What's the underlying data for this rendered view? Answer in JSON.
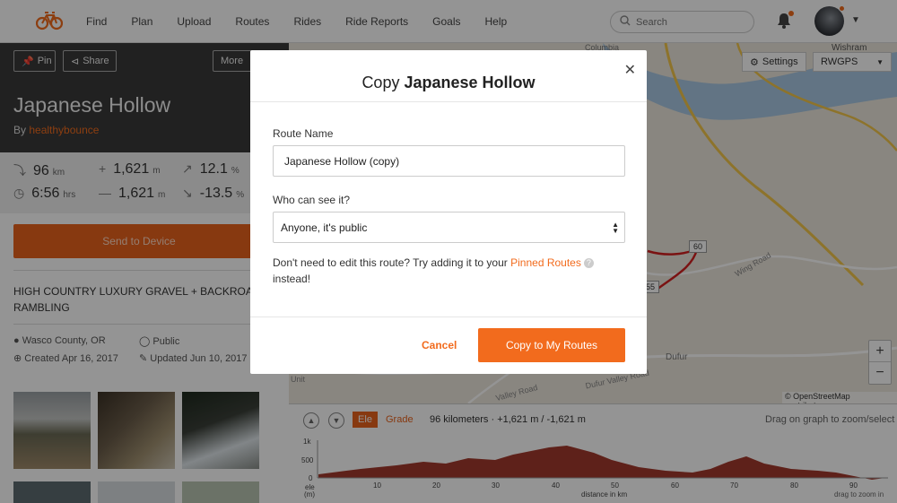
{
  "nav": {
    "items": [
      "Find",
      "Plan",
      "Upload",
      "Routes",
      "Rides",
      "Ride Reports",
      "Goals",
      "Help"
    ],
    "search_placeholder": "Search",
    "icons": [
      "bike-logo-icon",
      "search-icon",
      "bell-icon",
      "chevron-down-icon"
    ]
  },
  "route": {
    "pin_label": "Pin",
    "share_label": "Share",
    "more_label": "More",
    "title": "Japanese Hollow",
    "by_prefix": "By",
    "author": "healthybounce",
    "stats": {
      "distance": "96",
      "distance_unit": "km",
      "elev_gain": "1,621",
      "elev_gain_unit": "m",
      "grade_up": "12.1",
      "grade_up_unit": "%",
      "time": "6:56",
      "time_unit": "hrs",
      "elev_loss": "1,621",
      "elev_loss_unit": "m",
      "grade_down": "-13.5",
      "grade_down_unit": "%"
    },
    "send_label": "Send to Device",
    "description": "HIGH COUNTRY LUXURY GRAVEL + BACKROAD RAMBLING",
    "location": "Wasco County, OR",
    "visibility": "Public",
    "created": "Created Apr 16, 2017",
    "updated": "Updated Jun 10, 2017"
  },
  "map": {
    "settings_label": "Settings",
    "layer_label": "RWGPS",
    "labels": [
      "Columbia",
      "Wishram",
      "Wing Road",
      "Dufur Valley Road",
      "Dufur",
      "Valley Road",
      "Unit"
    ],
    "markers": [
      "60",
      "55"
    ],
    "zoom_in": "+",
    "zoom_out": "−",
    "attribution": "© OpenStreetMap contributors"
  },
  "elevation": {
    "tab_ele": "Ele",
    "tab_grade": "Grade",
    "summary": "96 kilometers · +1,621 m / -1,621 m",
    "drag_hint": "Drag on graph to zoom/select",
    "y_ticks": [
      "1k",
      "500",
      "0"
    ],
    "y_label_1": "ele",
    "y_label_2": "(m)",
    "x_label": "distance in km",
    "x_ticks": [
      "10",
      "20",
      "30",
      "40",
      "50",
      "60",
      "70",
      "80",
      "90"
    ],
    "drag_zoom_hint": "drag to zoom in"
  },
  "modal": {
    "title_prefix": "Copy",
    "title_name": "Japanese Hollow",
    "name_label": "Route Name",
    "name_value": "Japanese Hollow (copy)",
    "visibility_label": "Who can see it?",
    "visibility_value": "Anyone, it's public",
    "hint_before": "Don't need to edit this route? Try adding it to your",
    "hint_link": "Pinned Routes",
    "hint_after": "instead!",
    "cancel_label": "Cancel",
    "copy_label": "Copy to My Routes"
  },
  "colors": {
    "accent": "#f26b1d",
    "route_line": "#d32020",
    "elevation_fill": "#a33a2d"
  }
}
